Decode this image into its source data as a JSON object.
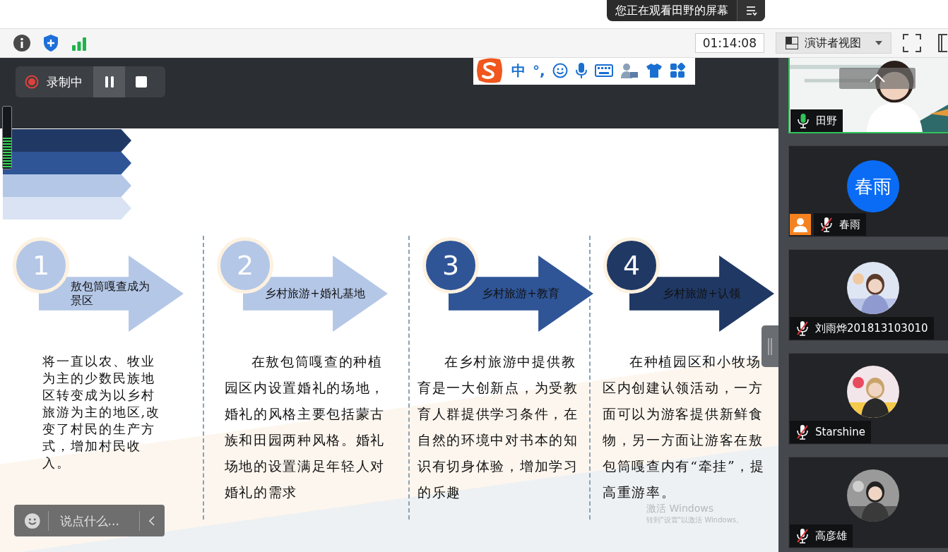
{
  "banner": {
    "text": "您正在观看田野的屏幕"
  },
  "toolbar": {
    "timer": "01:14:08",
    "view_mode": "演讲者视图"
  },
  "recording": {
    "label": "录制中"
  },
  "ime_bar": {
    "mode": "中",
    "punctuation": "°,"
  },
  "mic_meter": {
    "level": 0.5
  },
  "slide": {
    "steps": [
      {
        "number": "1",
        "kind": "plain",
        "color": "#b4c7e7",
        "title": "敖包筒嘎查成为景区",
        "body": "将一直以农、牧业为主的少数民族地区转变成为以乡村旅游为主的地区,改变了村民的生产方式，增加村民收入。"
      },
      {
        "number": "2",
        "kind": "indented",
        "color": "#b4c7e7",
        "title": "乡村旅游+婚礼基地",
        "body": "在敖包筒嘎查的种植园区内设置婚礼的场地，婚礼的风格主要包括蒙古族和田园两种风格。婚礼场地的设置满足年轻人对婚礼的需求"
      },
      {
        "number": "3",
        "kind": "indented",
        "color": "#2f5597",
        "title": "乡村旅游+教育",
        "body": "在乡村旅游中提供教育是一大创新点，为受教育人群提供学习条件，在自然的环境中对书本的知识有切身体验，增加学习的乐趣"
      },
      {
        "number": "4",
        "kind": "indented",
        "color": "#203864",
        "title": "乡村旅游+认领",
        "body": "在种植园区和小牧场区内创建认领活动，一方面可以为游客提供新鲜食物，另一方面让游客在敖包筒嘎查内有“牵挂”，提高重游率。"
      }
    ]
  },
  "chat": {
    "placeholder": "说点什么..."
  },
  "os_notice": {
    "title": "激活 Windows",
    "subtitle": "转到\"设置\"以激活 Windows。"
  },
  "participants": [
    {
      "name": "田野",
      "kind": "video",
      "muted": false,
      "host": false,
      "active": true
    },
    {
      "name": "春雨",
      "kind": "initials",
      "initials": "春雨",
      "muted": true,
      "host": true,
      "active": false
    },
    {
      "name": "刘雨烨201813103010",
      "kind": "picture",
      "muted": true,
      "host": false,
      "active": false
    },
    {
      "name": "Starshine",
      "kind": "picture",
      "muted": true,
      "host": false,
      "active": false
    },
    {
      "name": "高彦雄",
      "kind": "picture",
      "muted": true,
      "host": false,
      "active": false
    }
  ]
}
